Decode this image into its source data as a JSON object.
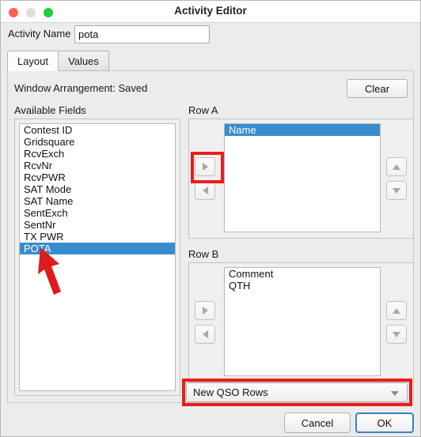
{
  "window": {
    "title": "Activity Editor",
    "controls": {
      "close": "close-button",
      "minimize": "minimize-button",
      "zoom": "zoom-button"
    }
  },
  "activity": {
    "label": "Activity Name",
    "value": "pota",
    "placeholder": ""
  },
  "tabs": [
    {
      "label": "Layout",
      "active": true
    },
    {
      "label": "Values",
      "active": false
    }
  ],
  "arrangement": {
    "label": "Window Arrangement:  Saved",
    "clear_label": "Clear"
  },
  "available_fields": {
    "label": "Available Fields",
    "items": [
      {
        "label": "Contest ID",
        "selected": false
      },
      {
        "label": "Gridsquare",
        "selected": false
      },
      {
        "label": "RcvExch",
        "selected": false
      },
      {
        "label": "RcvNr",
        "selected": false
      },
      {
        "label": "RcvPWR",
        "selected": false
      },
      {
        "label": "SAT Mode",
        "selected": false
      },
      {
        "label": "SAT Name",
        "selected": false
      },
      {
        "label": "SentExch",
        "selected": false
      },
      {
        "label": "SentNr",
        "selected": false
      },
      {
        "label": "TX PWR",
        "selected": false
      },
      {
        "label": "POTA",
        "selected": true
      }
    ]
  },
  "row_a": {
    "label": "Row A",
    "items": [
      {
        "label": "Name",
        "selected": true
      }
    ],
    "buttons": {
      "add": "add-to-row-a-button",
      "remove": "remove-from-row-a-button",
      "move_up": "move-up-row-a-button",
      "move_down": "move-down-row-a-button"
    }
  },
  "row_b": {
    "label": "Row B",
    "items": [
      {
        "label": "Comment",
        "selected": false
      },
      {
        "label": "QTH",
        "selected": false
      }
    ],
    "buttons": {
      "add": "add-to-row-b-button",
      "remove": "remove-from-row-b-button",
      "move_up": "move-up-row-b-button",
      "move_down": "move-down-row-b-button"
    }
  },
  "target_selector": {
    "value": "New QSO Rows"
  },
  "footer": {
    "cancel_label": "Cancel",
    "ok_label": "OK"
  },
  "annotations": {
    "highlight_color": "#ec1c1c",
    "arrow_color": "#e01b1b",
    "boxes": [
      {
        "name": "add-to-row-a-highlight"
      },
      {
        "name": "target-selector-highlight"
      }
    ]
  },
  "colors": {
    "selection_blue": "#3a8dcc",
    "focus_blue": "#3f7fbf",
    "window_bg": "#ececec",
    "close_red": "#ff6157",
    "minimize_gray": "#dedede",
    "zoom_green": "#20cf36"
  }
}
